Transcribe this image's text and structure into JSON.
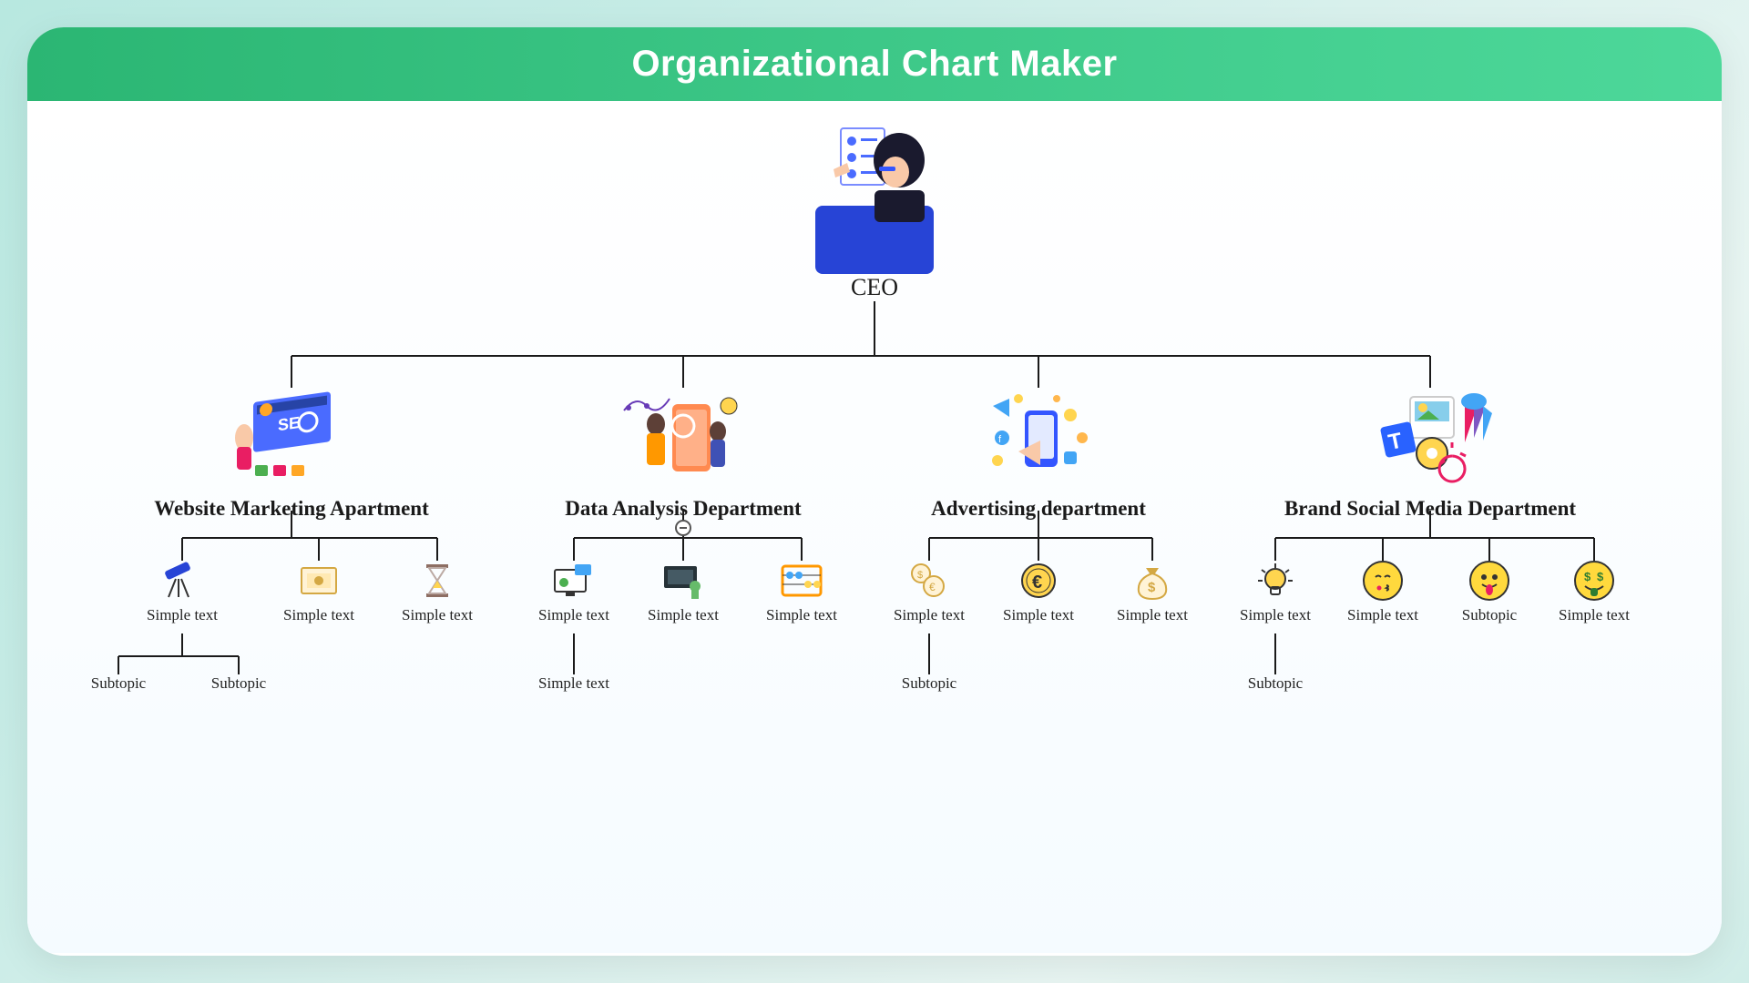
{
  "header": {
    "title": "Organizational Chart Maker"
  },
  "root": {
    "label": "CEO"
  },
  "departments": [
    {
      "label": "Website Marketing Apartment",
      "children": [
        {
          "label": "Simple text",
          "children": [
            {
              "label": "Subtopic"
            },
            {
              "label": "Subtopic"
            }
          ]
        },
        {
          "label": "Simple text"
        },
        {
          "label": "Simple text"
        }
      ]
    },
    {
      "label": "Data Analysis Department",
      "children": [
        {
          "label": "Simple text",
          "children": [
            {
              "label": "Simple text"
            }
          ]
        },
        {
          "label": "Simple text"
        },
        {
          "label": "Simple text"
        }
      ]
    },
    {
      "label": "Advertising department",
      "children": [
        {
          "label": "Simple text",
          "children": [
            {
              "label": "Subtopic"
            }
          ]
        },
        {
          "label": "Simple text"
        },
        {
          "label": "Simple text"
        }
      ]
    },
    {
      "label": "Brand Social Media Department",
      "children": [
        {
          "label": "Simple text",
          "children": [
            {
              "label": "Subtopic"
            }
          ]
        },
        {
          "label": "Simple text"
        },
        {
          "label": "Subtopic"
        },
        {
          "label": "Simple text"
        }
      ]
    }
  ]
}
